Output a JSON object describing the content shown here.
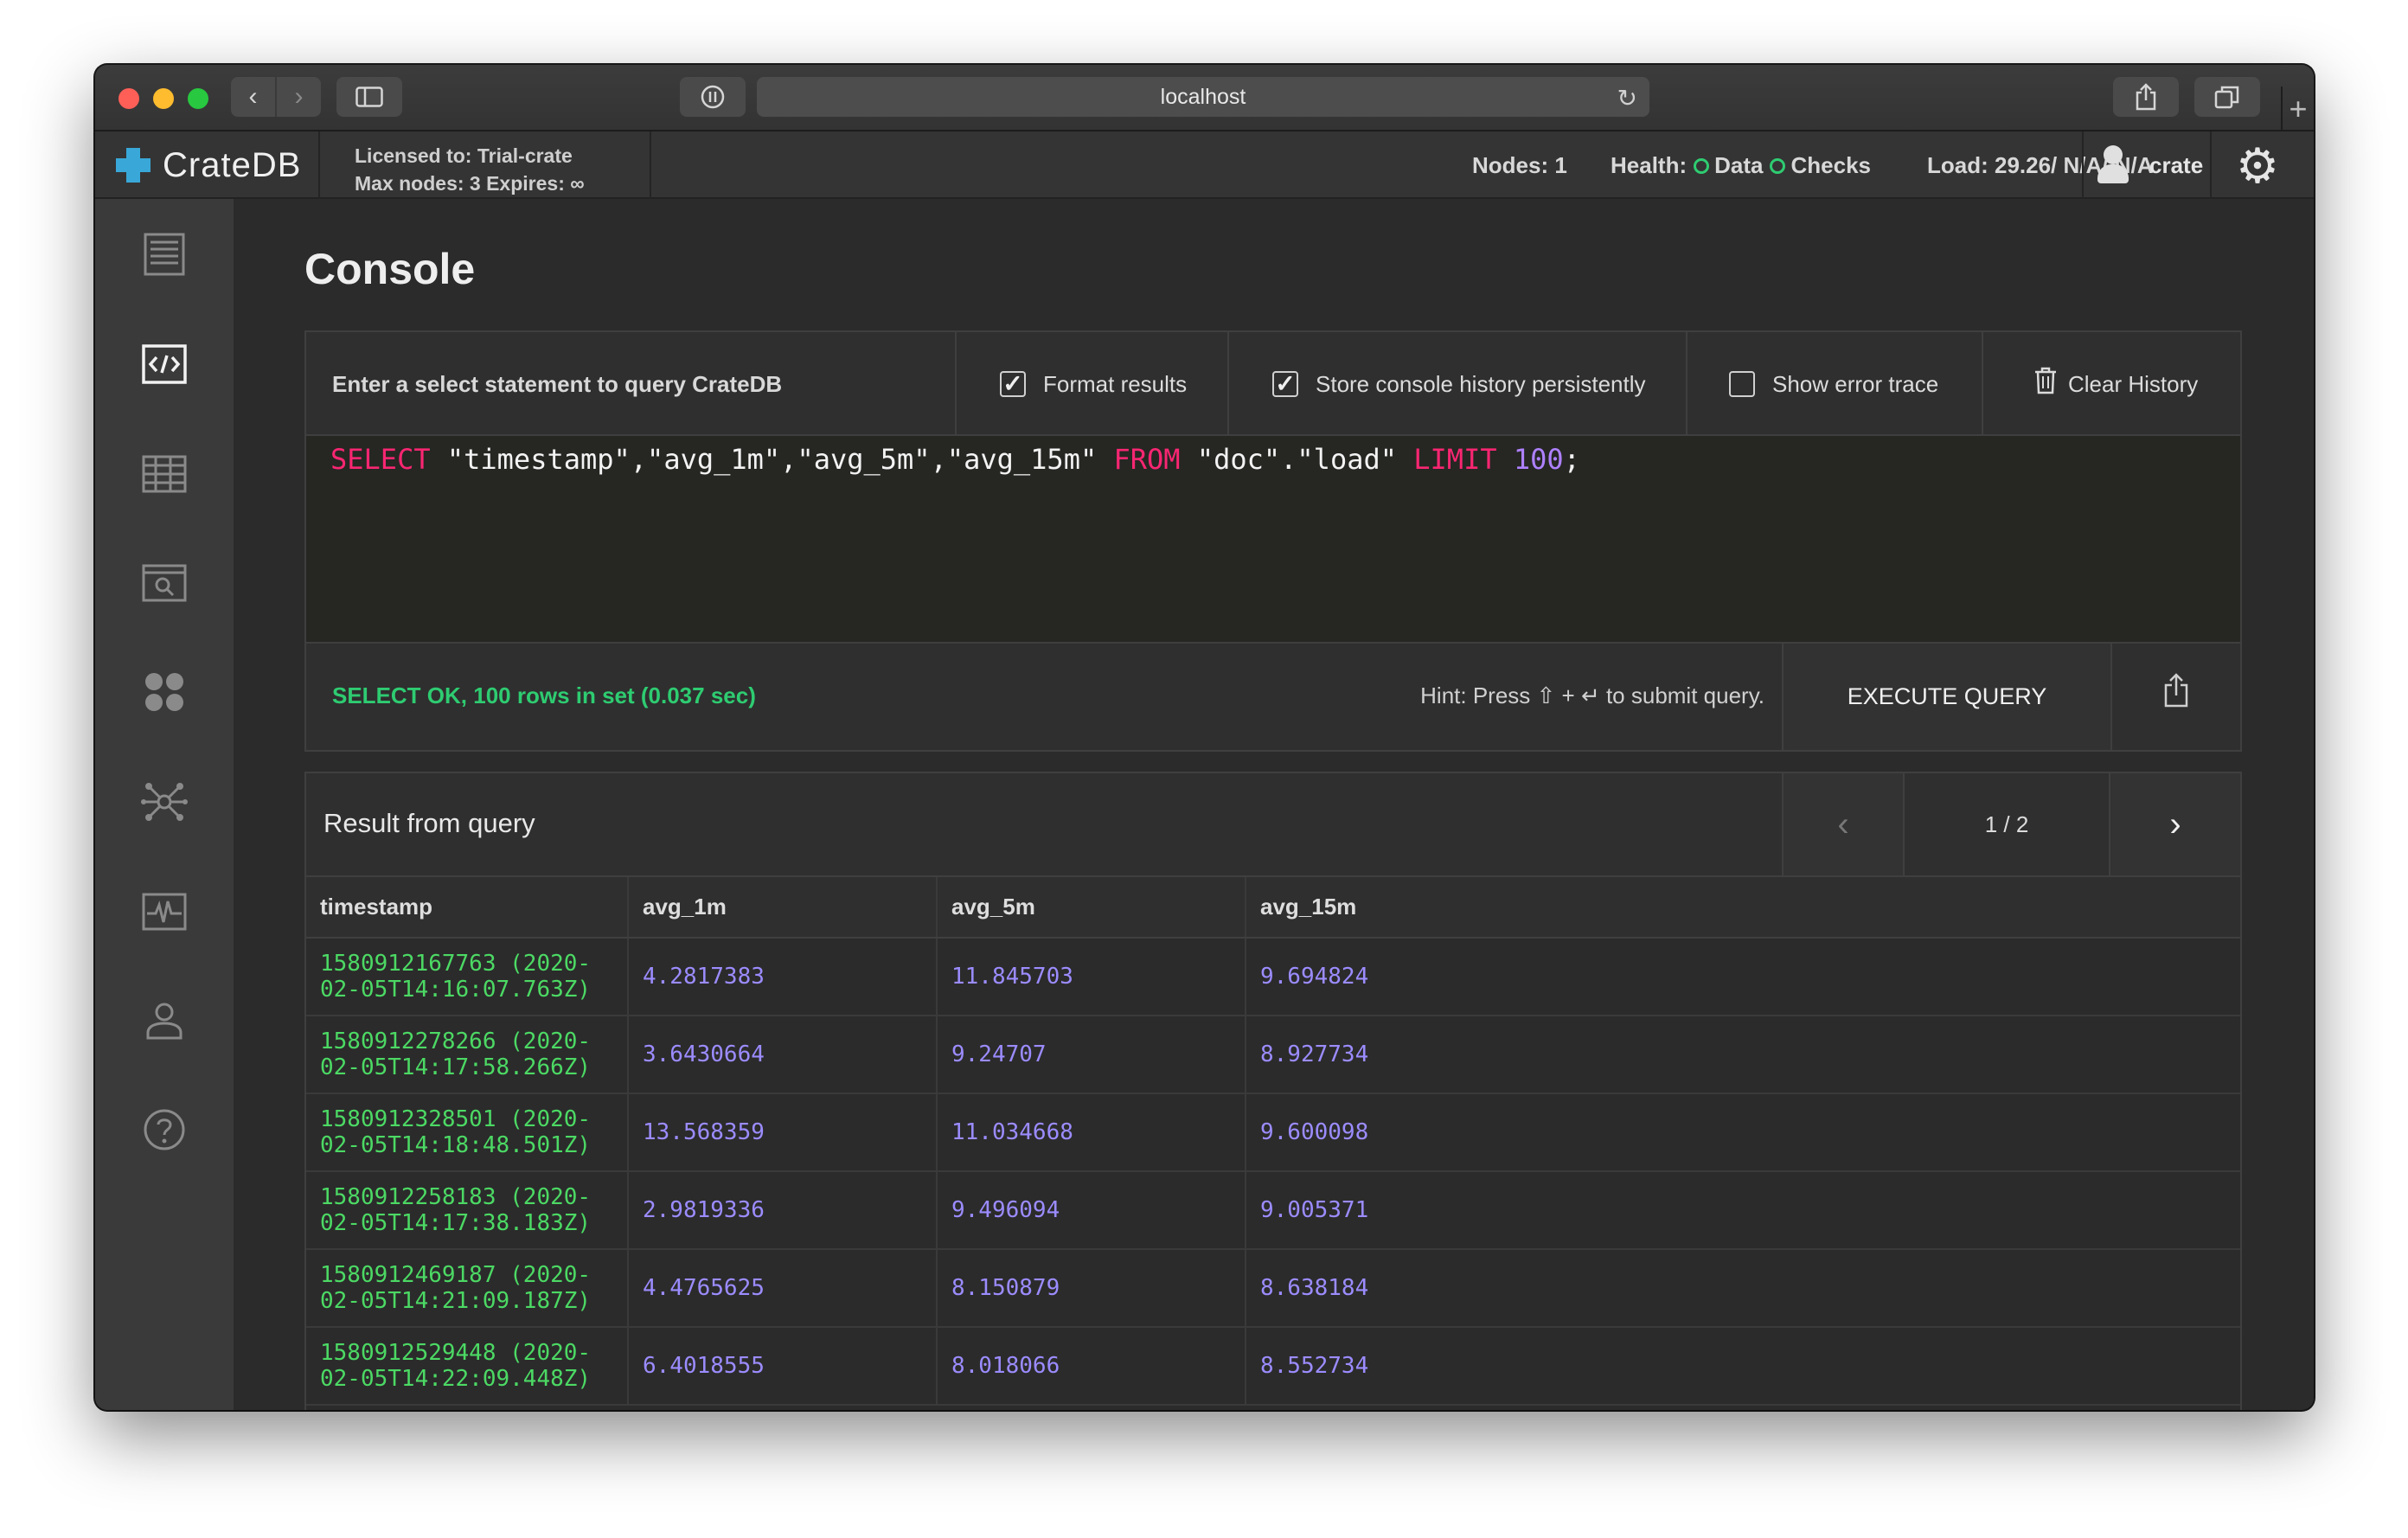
{
  "browser": {
    "url": "localhost",
    "nav_back": "‹",
    "nav_forward": "›",
    "new_tab": "+"
  },
  "app": {
    "logo_text": "CrateDB",
    "license_line1": "Licensed to: Trial-crate",
    "license_line2": "Max nodes: 3 Expires: ∞",
    "nodes": "Nodes: 1",
    "health_label": "Health:",
    "health_data": "Data",
    "health_checks": "Checks",
    "load": "Load: 29.26/ N/A/ N/A",
    "user": "crate",
    "colors": {
      "accent": "#39a8d8",
      "ok": "#2ecc71"
    }
  },
  "nav": [
    "overview-icon",
    "console-icon",
    "tables-icon",
    "views-icon",
    "shards-icon",
    "cluster-icon",
    "monitoring-icon",
    "users-icon",
    "help-icon"
  ],
  "console": {
    "title": "Console",
    "prompt": "Enter a select statement to query CrateDB",
    "format_results": "Format results",
    "format_results_checked": true,
    "store_history": "Store console history persistently",
    "store_history_checked": true,
    "show_error_trace": "Show error trace",
    "show_error_trace_checked": false,
    "clear_history": "Clear History",
    "query": {
      "kw_select": "SELECT",
      "columns": " \"timestamp\",\"avg_1m\",\"avg_5m\",\"avg_15m\" ",
      "kw_from": "FROM",
      "table": " \"doc\".\"load\" ",
      "kw_limit": "LIMIT",
      "limit": " 100",
      "end": ";"
    },
    "status": "SELECT OK, 100 rows in set (0.037 sec)",
    "hint": "Hint: Press ⇧ + ↵ to submit query.",
    "execute": "EXECUTE QUERY"
  },
  "results": {
    "title": "Result from query",
    "page": "1 / 2",
    "prev": "‹",
    "next": "›",
    "columns": [
      "timestamp",
      "avg_1m",
      "avg_5m",
      "avg_15m"
    ],
    "rows": [
      [
        "1580912167763 (2020-02-05T14:16:07.763Z)",
        "4.2817383",
        "11.845703",
        "9.694824"
      ],
      [
        "1580912278266 (2020-02-05T14:17:58.266Z)",
        "3.6430664",
        "9.24707",
        "8.927734"
      ],
      [
        "1580912328501 (2020-02-05T14:18:48.501Z)",
        "13.568359",
        "11.034668",
        "9.600098"
      ],
      [
        "1580912258183 (2020-02-05T14:17:38.183Z)",
        "2.9819336",
        "9.496094",
        "9.005371"
      ],
      [
        "1580912469187 (2020-02-05T14:21:09.187Z)",
        "4.4765625",
        "8.150879",
        "8.638184"
      ],
      [
        "1580912529448 (2020-02-05T14:22:09.448Z)",
        "6.4018555",
        "8.018066",
        "8.552734"
      ]
    ]
  }
}
